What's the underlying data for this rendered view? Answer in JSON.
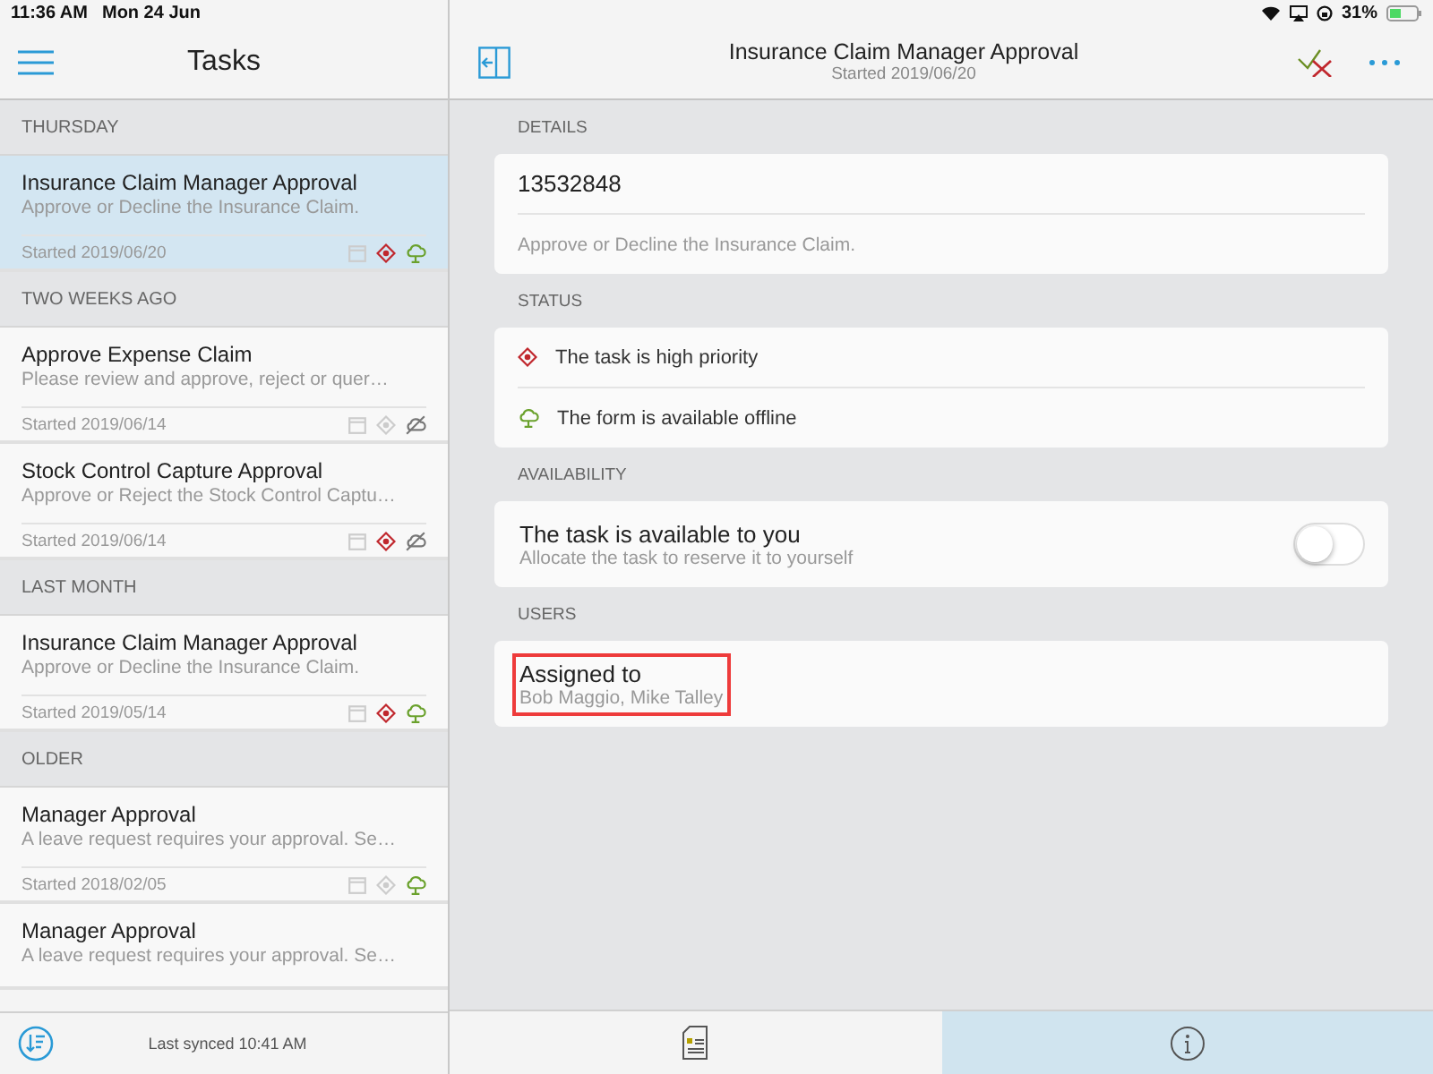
{
  "status_bar": {
    "time": "11:36 AM",
    "date": "Mon 24 Jun",
    "battery": "31%"
  },
  "sidebar": {
    "title": "Tasks",
    "sections": [
      {
        "heading": "THURSDAY",
        "tasks": [
          {
            "title": "Insurance Claim Manager Approval",
            "description": "Approve or Decline the Insurance Claim.",
            "started": "Started 2019/06/20",
            "selected": true,
            "high_priority": true,
            "offline": true
          }
        ]
      },
      {
        "heading": "TWO WEEKS AGO",
        "tasks": [
          {
            "title": "Approve Expense Claim",
            "description": "Please review and approve, reject or quer…",
            "started": "Started 2019/06/14",
            "selected": false,
            "high_priority": false,
            "offline": false
          },
          {
            "title": "Stock Control Capture Approval",
            "description": "Approve or Reject the Stock Control Captu…",
            "started": "Started 2019/06/14",
            "selected": false,
            "high_priority": true,
            "offline": false
          }
        ]
      },
      {
        "heading": "LAST MONTH",
        "tasks": [
          {
            "title": "Insurance Claim Manager Approval",
            "description": "Approve or Decline the Insurance Claim.",
            "started": "Started 2019/05/14",
            "selected": false,
            "high_priority": true,
            "offline": true
          }
        ]
      },
      {
        "heading": "OLDER",
        "tasks": [
          {
            "title": "Manager Approval",
            "description": "A leave request requires your approval. Se…",
            "started": "Started 2018/02/05",
            "selected": false,
            "high_priority": false,
            "offline": true
          },
          {
            "title": "Manager Approval",
            "description": "A leave request requires your approval. Se…",
            "selected": false
          }
        ]
      }
    ],
    "footer": "Last synced 10:41 AM"
  },
  "detail": {
    "title": "Insurance Claim Manager Approval",
    "subtitle": "Started 2019/06/20",
    "details_heading": "DETAILS",
    "reference": "13532848",
    "description": "Approve or Decline the Insurance Claim.",
    "status_heading": "STATUS",
    "status_items": [
      {
        "kind": "priority",
        "text": "The task is high priority"
      },
      {
        "kind": "offline",
        "text": "The form is available offline"
      }
    ],
    "availability_heading": "AVAILABILITY",
    "availability": {
      "title": "The task is available to you",
      "hint": "Allocate the task to reserve it to yourself",
      "on": false
    },
    "users_heading": "USERS",
    "users": {
      "label": "Assigned to",
      "names": "Bob Maggio, Mike Talley",
      "highlighted": true
    }
  },
  "bottom_tabs": [
    {
      "kind": "form",
      "selected": false
    },
    {
      "kind": "info",
      "selected": true
    }
  ]
}
